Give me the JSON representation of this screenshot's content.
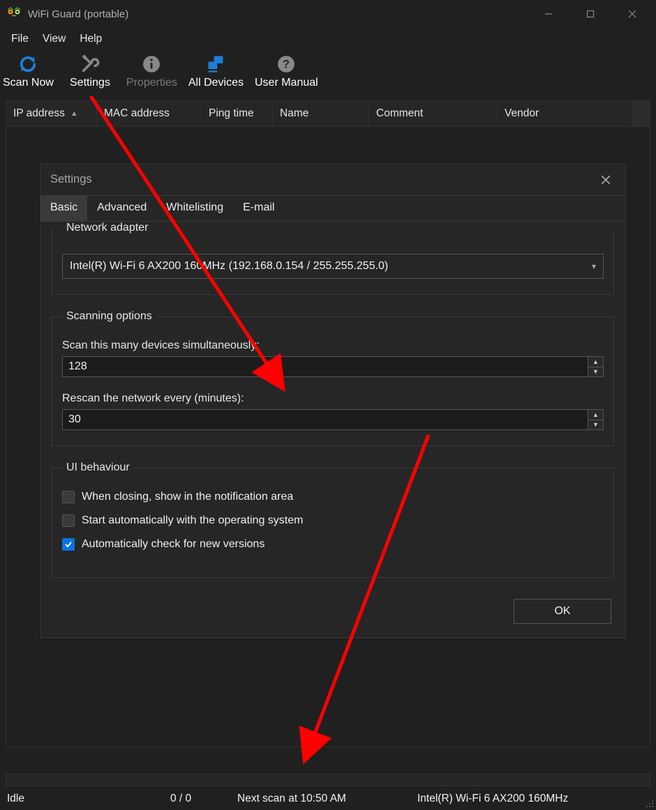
{
  "window": {
    "title": "WiFi Guard (portable)"
  },
  "menubar": {
    "file": "File",
    "view": "View",
    "help": "Help"
  },
  "toolbar": {
    "scan_now": "Scan Now",
    "settings": "Settings",
    "properties": "Properties",
    "all_devices": "All Devices",
    "user_manual": "User Manual"
  },
  "table": {
    "headers": {
      "ip": "IP address",
      "mac": "MAC address",
      "ping": "Ping time",
      "name": "Name",
      "comment": "Comment",
      "vendor": "Vendor"
    }
  },
  "dialog": {
    "title": "Settings",
    "tabs": {
      "basic": "Basic",
      "advanced": "Advanced",
      "whitelisting": "Whitelisting",
      "email": "E-mail"
    },
    "adapter": {
      "legend": "Network adapter",
      "selected": "Intel(R) Wi-Fi 6 AX200 160MHz (192.168.0.154 / 255.255.255.0)"
    },
    "scanning": {
      "legend": "Scanning options",
      "simul_label": "Scan this many devices simultaneously:",
      "simul_value": "128",
      "rescan_label": "Rescan the network every (minutes):",
      "rescan_value": "30"
    },
    "ui_behaviour": {
      "legend": "UI behaviour",
      "notif_label": "When closing, show in the notification area",
      "autostart_label": "Start automatically with the operating system",
      "autoupdate_label": "Automatically check for new versions"
    },
    "ok": "OK"
  },
  "status": {
    "state": "Idle",
    "count": "0 / 0",
    "next_scan": "Next scan at 10:50 AM",
    "adapter": "Intel(R) Wi-Fi 6 AX200 160MHz"
  }
}
